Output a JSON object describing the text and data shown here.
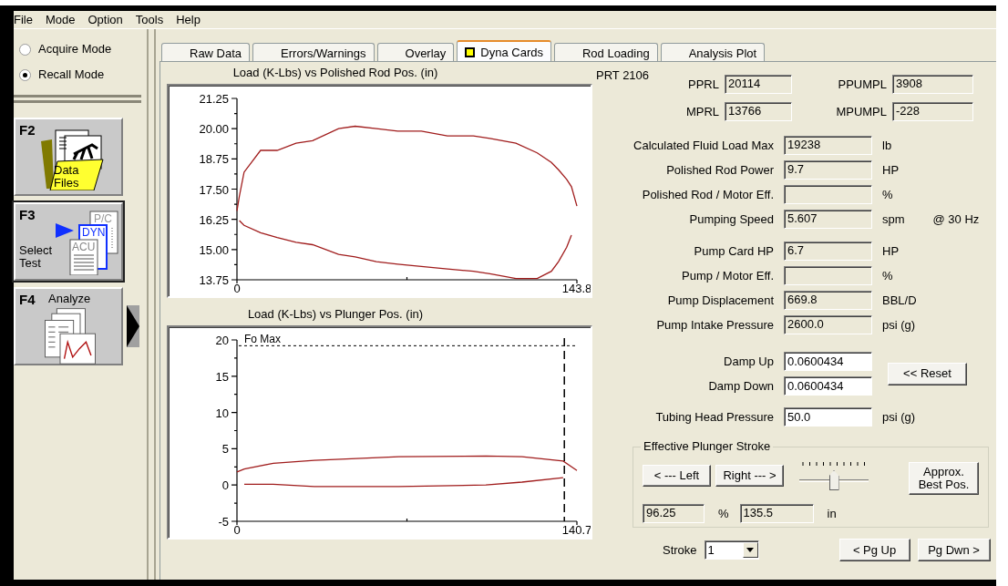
{
  "menu": [
    {
      "label": "File"
    },
    {
      "label": "Mode"
    },
    {
      "label": "Option"
    },
    {
      "label": "Tools"
    },
    {
      "label": "Help"
    }
  ],
  "mode_options": [
    {
      "label": "Acquire Mode",
      "selected": false
    },
    {
      "label": "Recall Mode",
      "selected": true
    }
  ],
  "function_keys": [
    {
      "key": "F2",
      "kind": "files",
      "label": "Data Files",
      "selected": false
    },
    {
      "key": "F3",
      "kind": "test",
      "label": "Select Test",
      "doc_labels": [
        "P/C",
        "DYN",
        "ACU"
      ],
      "selected": true
    },
    {
      "key": "F4",
      "kind": "analyze",
      "label": "Analyze",
      "selected": false
    }
  ],
  "tabs": [
    {
      "label": "Raw Data",
      "selected": false,
      "indicator": false
    },
    {
      "label": "Errors/Warnings",
      "selected": false,
      "indicator": false
    },
    {
      "label": "Overlay",
      "selected": false,
      "indicator": false
    },
    {
      "label": "Dyna Cards",
      "selected": true,
      "indicator": true
    },
    {
      "label": "Rod Loading",
      "selected": false,
      "indicator": false
    },
    {
      "label": "Analysis Plot",
      "selected": false,
      "indicator": false
    }
  ],
  "charts": [
    {
      "title": "Load (K-Lbs) vs Polished Rod Pos. (in)",
      "chart_data": {
        "type": "line",
        "xlim": [
          0,
          143.8
        ],
        "ylim": [
          13.75,
          21.25
        ],
        "xticks": [
          0,
          {
            "value": 143.8,
            "label": "143.8"
          }
        ],
        "yticks": [
          {
            "value": 13.75,
            "label": "13.75"
          },
          {
            "value": 15,
            "label": "15.00"
          },
          {
            "value": 16.25,
            "label": "16.25"
          },
          {
            "value": 17.5,
            "label": "17.50"
          },
          {
            "value": 18.75,
            "label": "18.75"
          },
          {
            "value": 20,
            "label": "20.00"
          },
          {
            "value": 21.25,
            "label": "21.25"
          }
        ],
        "x": [
          0,
          1,
          3,
          10,
          17,
          25,
          32,
          43,
          50,
          59,
          68,
          78,
          89,
          100,
          107,
          118,
          127,
          133,
          136,
          139.5,
          141.5,
          143.8
        ],
        "series": [
          {
            "color": "#a01c1c",
            "values": [
              16.6,
              17.2,
              18.2,
              19.1,
              19.1,
              19.4,
              19.5,
              20.0,
              20.1,
              20.0,
              19.9,
              19.9,
              19.7,
              19.7,
              19.6,
              19.4,
              19.0,
              18.6,
              18.3,
              17.9,
              17.6,
              16.8
            ]
          },
          {
            "color": "#a01c1c",
            "values": [
              null,
              16.2,
              16.0,
              15.7,
              15.5,
              15.3,
              15.2,
              14.8,
              14.7,
              14.5,
              14.4,
              14.3,
              14.2,
              14.1,
              14.0,
              13.8,
              13.8,
              14.1,
              14.5,
              15.1,
              15.6,
              null
            ]
          }
        ]
      }
    },
    {
      "title": "Load (K-Lbs) vs Plunger Pos. (in)",
      "chart_data": {
        "type": "line",
        "xlim": [
          0,
          140.7
        ],
        "ylim": [
          -5,
          20
        ],
        "xticks": [
          0,
          {
            "value": 140.7,
            "label": "140.7"
          }
        ],
        "yticks": [
          -5,
          0,
          5,
          10,
          15,
          20
        ],
        "x": [
          0,
          3,
          15,
          32,
          67,
          103,
          118,
          135,
          140.7
        ],
        "series": [
          {
            "color": "#a01c1c",
            "values": [
              1.8,
              2.2,
              3.0,
              3.4,
              3.9,
              4.0,
              3.9,
              3.3,
              2.0
            ]
          },
          {
            "color": "#a01c1c",
            "values": [
              null,
              0.1,
              0.1,
              -0.2,
              -0.2,
              0.0,
              0.4,
              1.0,
              null
            ]
          }
        ],
        "ref_lines": [
          {
            "axis": "y",
            "value": 19.2,
            "label": "Fo Max"
          },
          {
            "axis": "x",
            "value": 135.5
          }
        ]
      }
    }
  ],
  "well_id": "PRT 2106",
  "load_fields": [
    {
      "label": "PPRL",
      "value": "20114"
    },
    {
      "label": "PPUMPL",
      "value": "3908"
    },
    {
      "label": "MPRL",
      "value": "13766"
    },
    {
      "label": "MPUMPL",
      "value": "-228"
    }
  ],
  "rod_results": [
    {
      "label": "Calculated Fluid Load Max",
      "value": "19238",
      "unit": "lb"
    },
    {
      "label": "Polished Rod Power",
      "value": "9.7",
      "unit": "HP"
    },
    {
      "label": "Polished Rod / Motor Eff.",
      "unit": "%"
    },
    {
      "label": "Pumping Speed",
      "value": "5.607",
      "unit": "spm",
      "note": "@ 30 Hz"
    }
  ],
  "pump_results": [
    {
      "label": "Pump Card HP",
      "value": "6.7",
      "unit": "HP"
    },
    {
      "label": "Pump / Motor Eff.",
      "unit": "%"
    },
    {
      "label": "Pump Displacement",
      "value": "669.8",
      "unit": "BBL/D"
    },
    {
      "label": "Pump Intake Pressure",
      "value": "2600.0",
      "unit": "psi (g)"
    }
  ],
  "damping": [
    {
      "label": "Damp Up",
      "value": "0.0600434"
    },
    {
      "label": "Damp Down",
      "value": "0.0600434"
    }
  ],
  "reset_button": "<< Reset",
  "tubing_head_pressure": {
    "label": "Tubing Head Pressure",
    "value": "50.0",
    "unit": "psi (g)"
  },
  "plunger_stroke": {
    "title": "Effective Plunger Stroke",
    "left_button": "< --- Left",
    "right_button": "Right --- >",
    "slider": {
      "level": 0.5
    },
    "best_button": "Approx. Best Pos.",
    "percent": {
      "value": "96.25",
      "unit": "%"
    },
    "length": {
      "value": "135.5",
      "unit": "in"
    }
  },
  "stroke": {
    "label": "Stroke",
    "value": "1"
  },
  "page_buttons": [
    "< Pg Up",
    "Pg Dwn >"
  ]
}
